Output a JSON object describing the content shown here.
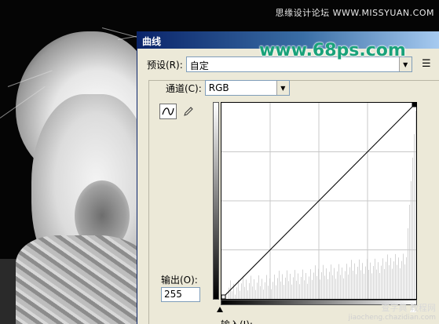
{
  "site_credit_top": "思缘设计论坛 WWW.MISSYUAN.COM",
  "watermark": "www.68ps.com",
  "dialog": {
    "title": "曲线",
    "preset_label": "预设(R):",
    "preset_value": "自定",
    "channel_label": "通道(C):",
    "channel_value": "RGB",
    "output_label": "输出(O):",
    "output_value": "255",
    "input_label": "输入(I):"
  },
  "chart_data": {
    "type": "line",
    "x": [
      0,
      255
    ],
    "y": [
      0,
      255
    ],
    "xlim": [
      0,
      255
    ],
    "ylim": [
      0,
      255
    ],
    "grid": true,
    "grid_divisions": 4
  },
  "footer_credit": {
    "title": "查字典 教程网",
    "url": "jiaocheng.chazidian.com"
  },
  "colors": {
    "watermark": "#19a27a",
    "titlebar_start": "#0a246a",
    "dialog_bg": "#ece9d8"
  }
}
